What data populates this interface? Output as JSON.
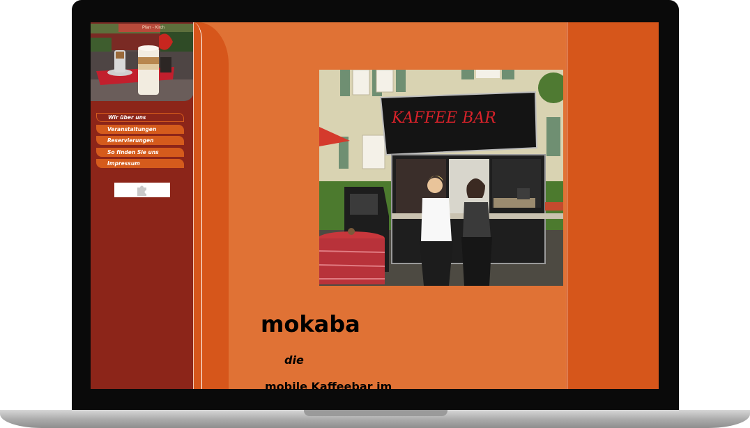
{
  "colors": {
    "content_bg": "#e07235",
    "sidebar_bg": "#8c2519",
    "accent_orange": "#d6561b",
    "nav_item_bg": "#d55b1c"
  },
  "nav": {
    "items": [
      {
        "label": "Wir über uns",
        "active": true
      },
      {
        "label": "Veranstaltungen"
      },
      {
        "label": "Reservierungen"
      },
      {
        "label": "So finden Sie uns"
      },
      {
        "label": "Impressum"
      }
    ]
  },
  "sidebar_photo": {
    "sign_text": "Pfarr - Kirch"
  },
  "plugin_placeholder": {
    "icon": "puzzle-piece-icon"
  },
  "hero": {
    "sign_text": "KAFFEE BAR"
  },
  "content": {
    "title": "mokaba",
    "subtitle_1": "die",
    "subtitle_2": "mobile Kaffeebar im"
  }
}
